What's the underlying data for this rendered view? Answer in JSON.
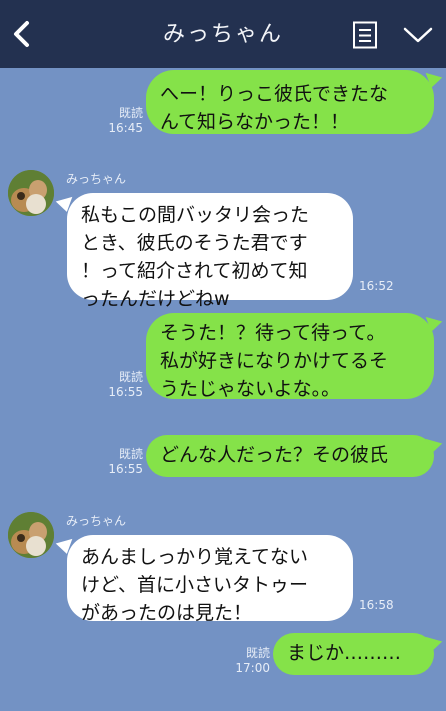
{
  "header": {
    "title": "みっちゃん",
    "back_icon": "chevron-left-icon",
    "menu_icon": "document-list-icon",
    "collapse_icon": "chevron-down-icon",
    "background": "#233150"
  },
  "colors": {
    "chat_background": "#7392c4",
    "outgoing_bubble": "#85e249",
    "incoming_bubble": "#ffffff"
  },
  "messages": [
    {
      "dir": "out",
      "text": "へー！りっこ彼氏できたな\nんて知らなかった！！",
      "read": "既読",
      "time": "16:45"
    },
    {
      "dir": "in",
      "sender": "みっちゃん",
      "text": "私もこの間バッタリ会った\nとき、彼氏のそうた君です\n！って紹介されて初めて知\nったんだけどねw",
      "time": "16:52"
    },
    {
      "dir": "out",
      "text": "そうた！？待って待って。\n私が好きになりかけてるそ\nうたじゃないよな。。",
      "read": "既読",
      "time": "16:55"
    },
    {
      "dir": "out",
      "text": "どんな人だった？その彼氏",
      "read": "既読",
      "time": "16:55"
    },
    {
      "dir": "in",
      "sender": "みっちゃん",
      "text": "あんましっかり覚えてない\nけど、首に小さいタトゥー\nがあったのは見た！",
      "time": "16:58"
    },
    {
      "dir": "out",
      "text": "まじか………",
      "read": "既読",
      "time": "17:00"
    }
  ]
}
